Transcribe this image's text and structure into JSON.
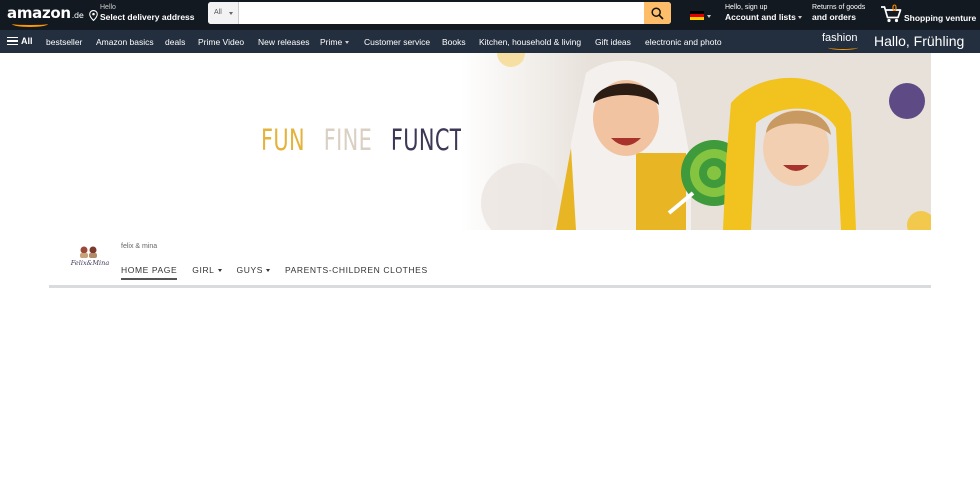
{
  "header": {
    "logo": "amazon",
    "logo_tld": ".de",
    "deliver_line1": "Hello",
    "deliver_line2": "Select delivery address",
    "search_category": "All",
    "search_placeholder": "",
    "account_line1": "Hello, sign up",
    "account_line2": "Account and lists",
    "returns_line1": "Returns of goods",
    "returns_line2": "and orders",
    "cart_count": "0",
    "cart_label": "Shopping venture",
    "icons": [
      "location-pin-icon",
      "search-icon",
      "german-flag-icon",
      "cart-icon"
    ]
  },
  "nav": {
    "all_label": "All",
    "items": [
      "bestseller",
      "Amazon basics",
      "deals",
      "Prime Video",
      "New releases",
      "Prime",
      "Customer service",
      "Books",
      "Kitchen, household & living",
      "Gift ideas",
      "electronic and photo"
    ],
    "fashion_label": "fashion",
    "greeting": "Hallo, Frühling"
  },
  "banner": {
    "words": [
      "FUN",
      "FINE",
      "FUNCTIONAL"
    ],
    "word_colors": [
      "#e4b33c",
      "#d9cfc3",
      "#3e3857"
    ]
  },
  "store": {
    "brand_name": "felix & mina",
    "logo_text": "Felix&Mina",
    "tabs": [
      "HOME PAGE",
      "GIRL",
      "GUYS",
      "PARENTS-CHILDREN CLOTHES"
    ]
  },
  "colors": {
    "topbar": "#131921",
    "navbar": "#232f3e",
    "search_button": "#febd69",
    "accent": "#ff9900"
  }
}
